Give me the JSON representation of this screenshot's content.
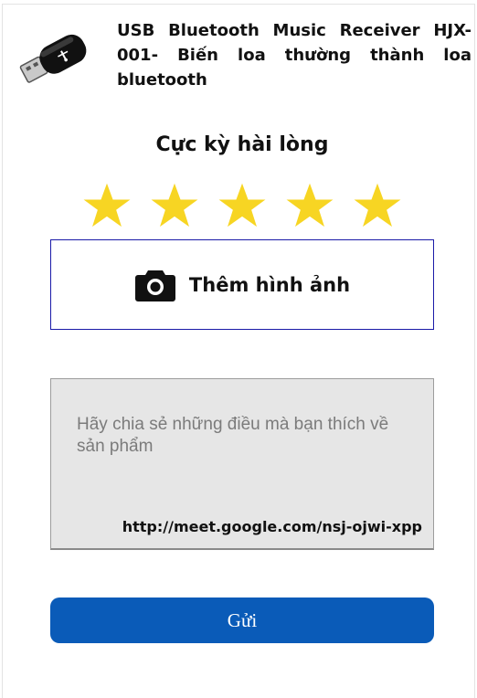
{
  "product": {
    "title": "USB Bluetooth Music Receiver HJX-001- Biến loa thường thành loa bluetooth",
    "thumbnail_icon": "usb-dongle-icon"
  },
  "rating": {
    "label": "Cực kỳ hài lòng",
    "value": 5,
    "max": 5,
    "star_color": "#f7d523"
  },
  "add_photo": {
    "icon": "camera-icon",
    "label": "Thêm hình ảnh"
  },
  "review": {
    "placeholder": "Hãy chia sẻ những điều mà bạn thích về sản phẩm",
    "value": "",
    "link_text": "http://meet.google.com/nsj-ojwi-xpp"
  },
  "submit": {
    "label": "Gửi",
    "color": "#0a5bb8"
  }
}
